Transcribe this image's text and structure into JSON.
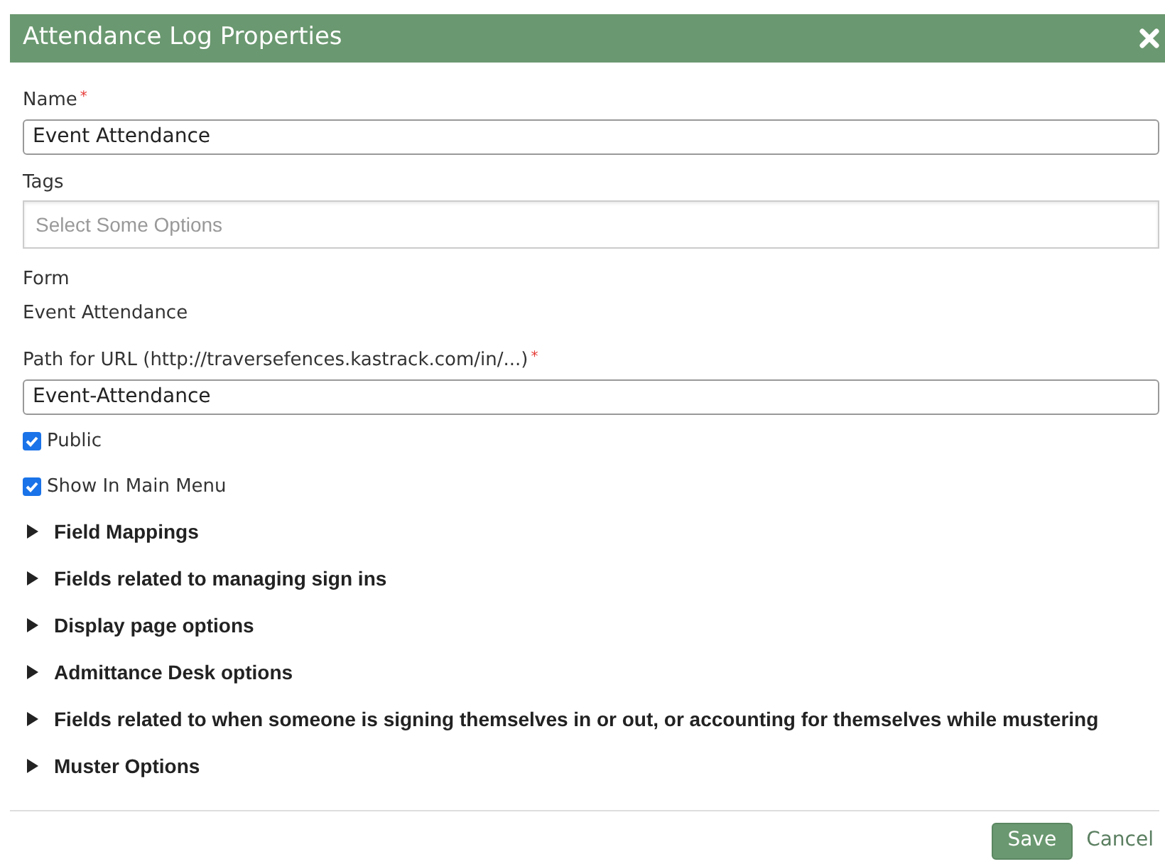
{
  "dialog": {
    "title": "Attendance Log Properties"
  },
  "fields": [
    {
      "kind": "input",
      "label": "Name",
      "required_mark": "*",
      "value": "Event Attendance"
    },
    {
      "kind": "select",
      "label": "Tags",
      "placeholder": "Select Some Options"
    },
    {
      "kind": "static",
      "label": "Form",
      "value": "Event Attendance"
    },
    {
      "kind": "input",
      "label": "Path for URL (http://traversefences.kastrack.com/in/...)",
      "required_mark": "*",
      "value": "Event-Attendance"
    },
    {
      "kind": "checkbox",
      "label": "Public",
      "checked": true
    },
    {
      "kind": "checkbox",
      "label": "Show In Main Menu",
      "checked": true
    }
  ],
  "sections": [
    {
      "title": "Field Mappings",
      "expanded": false
    },
    {
      "title": "Fields related to managing sign ins",
      "expanded": false
    },
    {
      "title": "Display page options",
      "expanded": false
    },
    {
      "title": "Admittance Desk options",
      "expanded": false
    },
    {
      "title": "Fields related to when someone is signing themselves in or out, or accounting for themselves while mustering",
      "expanded": false
    },
    {
      "title": "Muster Options",
      "expanded": false
    }
  ],
  "buttons": [
    {
      "kind": "primary",
      "label": "Save"
    },
    {
      "kind": "link",
      "label": "Cancel"
    }
  ]
}
